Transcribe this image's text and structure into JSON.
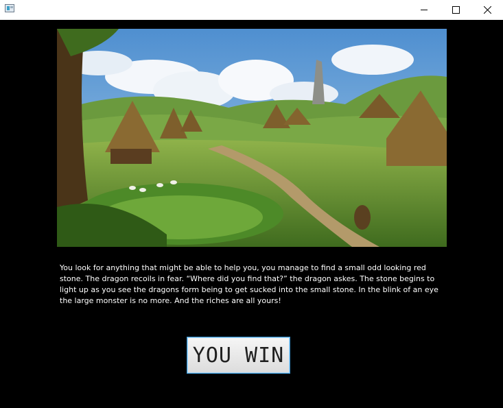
{
  "window": {
    "icons": {
      "app": "app-icon",
      "minimize": "minimize-icon",
      "maximize": "maximize-icon",
      "close": "close-icon"
    }
  },
  "scene": {
    "colors": {
      "sky": "#6fa8dc",
      "grass": "#5f8f2a",
      "thatch": "#8a6a32",
      "path": "#b39a6a"
    }
  },
  "story": {
    "text": "You look for anything that might be able to help you, you manage to find a small odd looking red stone. The dragon recoils in fear. “Where did you find that?” the dragon askes. The stone begins to light up as you see the dragons form being to get sucked into the small stone. In the blink of an eye the large monster is no more. And the riches are all yours!"
  },
  "result": {
    "button_label": "YOU WIN",
    "accent_color": "#3c9ad8"
  }
}
